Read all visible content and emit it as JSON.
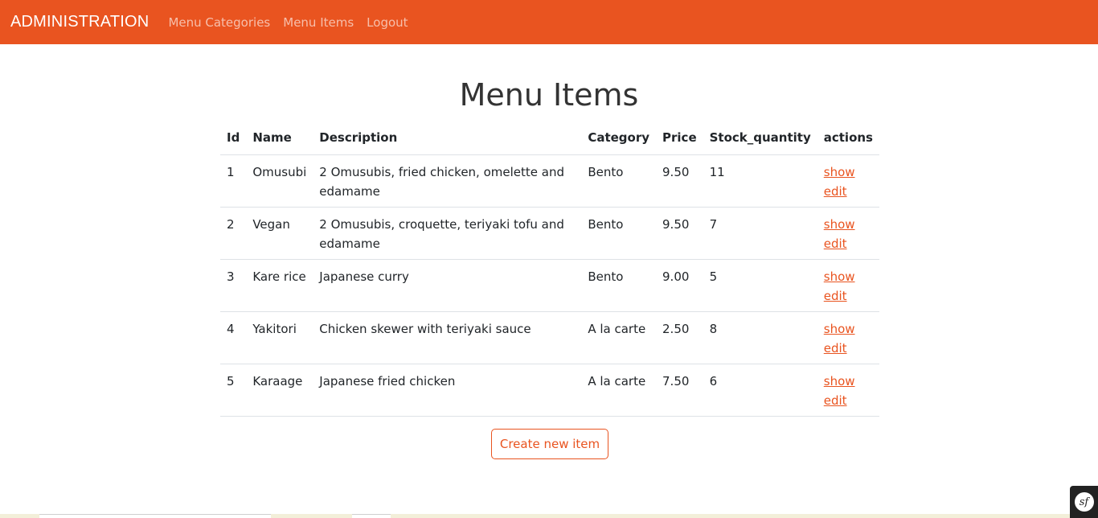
{
  "navbar": {
    "brand": "ADMINISTRATION",
    "links": [
      {
        "label": "Menu Categories"
      },
      {
        "label": "Menu Items"
      },
      {
        "label": "Logout"
      }
    ],
    "color": "#e95420"
  },
  "page": {
    "title": "Menu Items"
  },
  "table": {
    "headers": [
      "Id",
      "Name",
      "Description",
      "Category",
      "Price",
      "Stock_quantity",
      "actions"
    ],
    "rows": [
      {
        "id": "1",
        "name": "Omusubi",
        "description": "2 Omusubis, fried chicken, omelette and edamame",
        "category": "Bento",
        "price": "9.50",
        "stock": "11",
        "show": "show",
        "edit": "edit"
      },
      {
        "id": "2",
        "name": "Vegan",
        "description": "2 Omusubis, croquette, teriyaki tofu and edamame",
        "category": "Bento",
        "price": "9.50",
        "stock": "7",
        "show": "show",
        "edit": "edit"
      },
      {
        "id": "3",
        "name": "Kare rice",
        "description": "Japanese curry",
        "category": "Bento",
        "price": "9.00",
        "stock": "5",
        "show": "show",
        "edit": "edit"
      },
      {
        "id": "4",
        "name": "Yakitori",
        "description": "Chicken skewer with teriyaki sauce",
        "category": "A la carte",
        "price": "2.50",
        "stock": "8",
        "show": "show",
        "edit": "edit"
      },
      {
        "id": "5",
        "name": "Karaage",
        "description": "Japanese fried chicken",
        "category": "A la carte",
        "price": "7.50",
        "stock": "6",
        "show": "show",
        "edit": "edit"
      }
    ]
  },
  "create_button": {
    "label": "Create new item"
  },
  "debug_toolbar": {
    "icon": "symfony-logo-icon",
    "label": "sf"
  }
}
